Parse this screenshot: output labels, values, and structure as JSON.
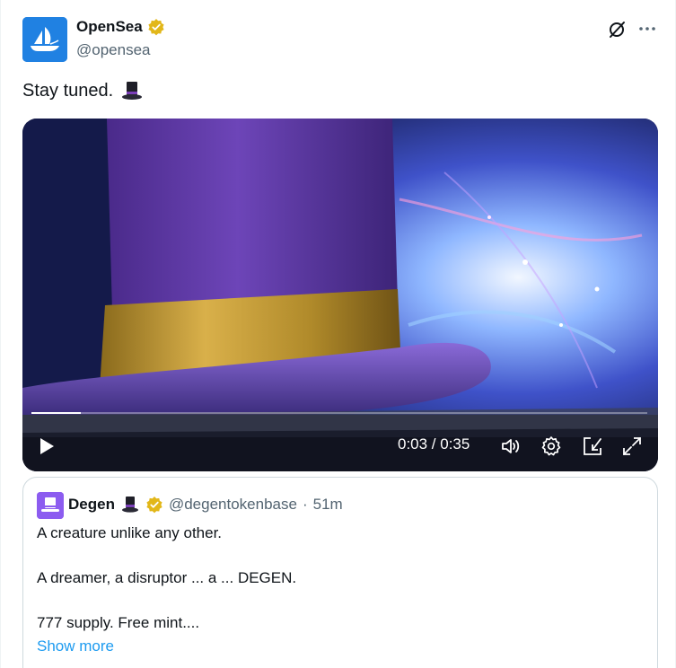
{
  "author": {
    "display_name": "OpenSea",
    "handle": "@opensea",
    "avatar_icon": "opensea-logo-icon",
    "verified_icon": "verified-badge-icon"
  },
  "tweet": {
    "text": "Stay tuned.",
    "emoji": "top-hat-emoji"
  },
  "video": {
    "time_display": "0:03 / 0:35",
    "progress": 0.08,
    "controls": [
      "play-icon",
      "volume-icon",
      "gear-icon",
      "picture-in-picture-icon",
      "fullscreen-icon"
    ]
  },
  "quoted_tweet": {
    "display_name": "Degen",
    "handle": "@degentokenbase",
    "separator": "·",
    "time": "51m",
    "lines": [
      "A creature unlike any other.",
      "A dreamer, a disruptor ... a ... DEGEN.",
      "777 supply. Free mint...."
    ],
    "show_more": "Show more"
  },
  "colors": {
    "brand_blue": "#2081e2",
    "link_blue": "#1d9bf0",
    "verified_gold": "#e2b719",
    "secondary_text": "#536471",
    "border": "#cfd9de"
  }
}
